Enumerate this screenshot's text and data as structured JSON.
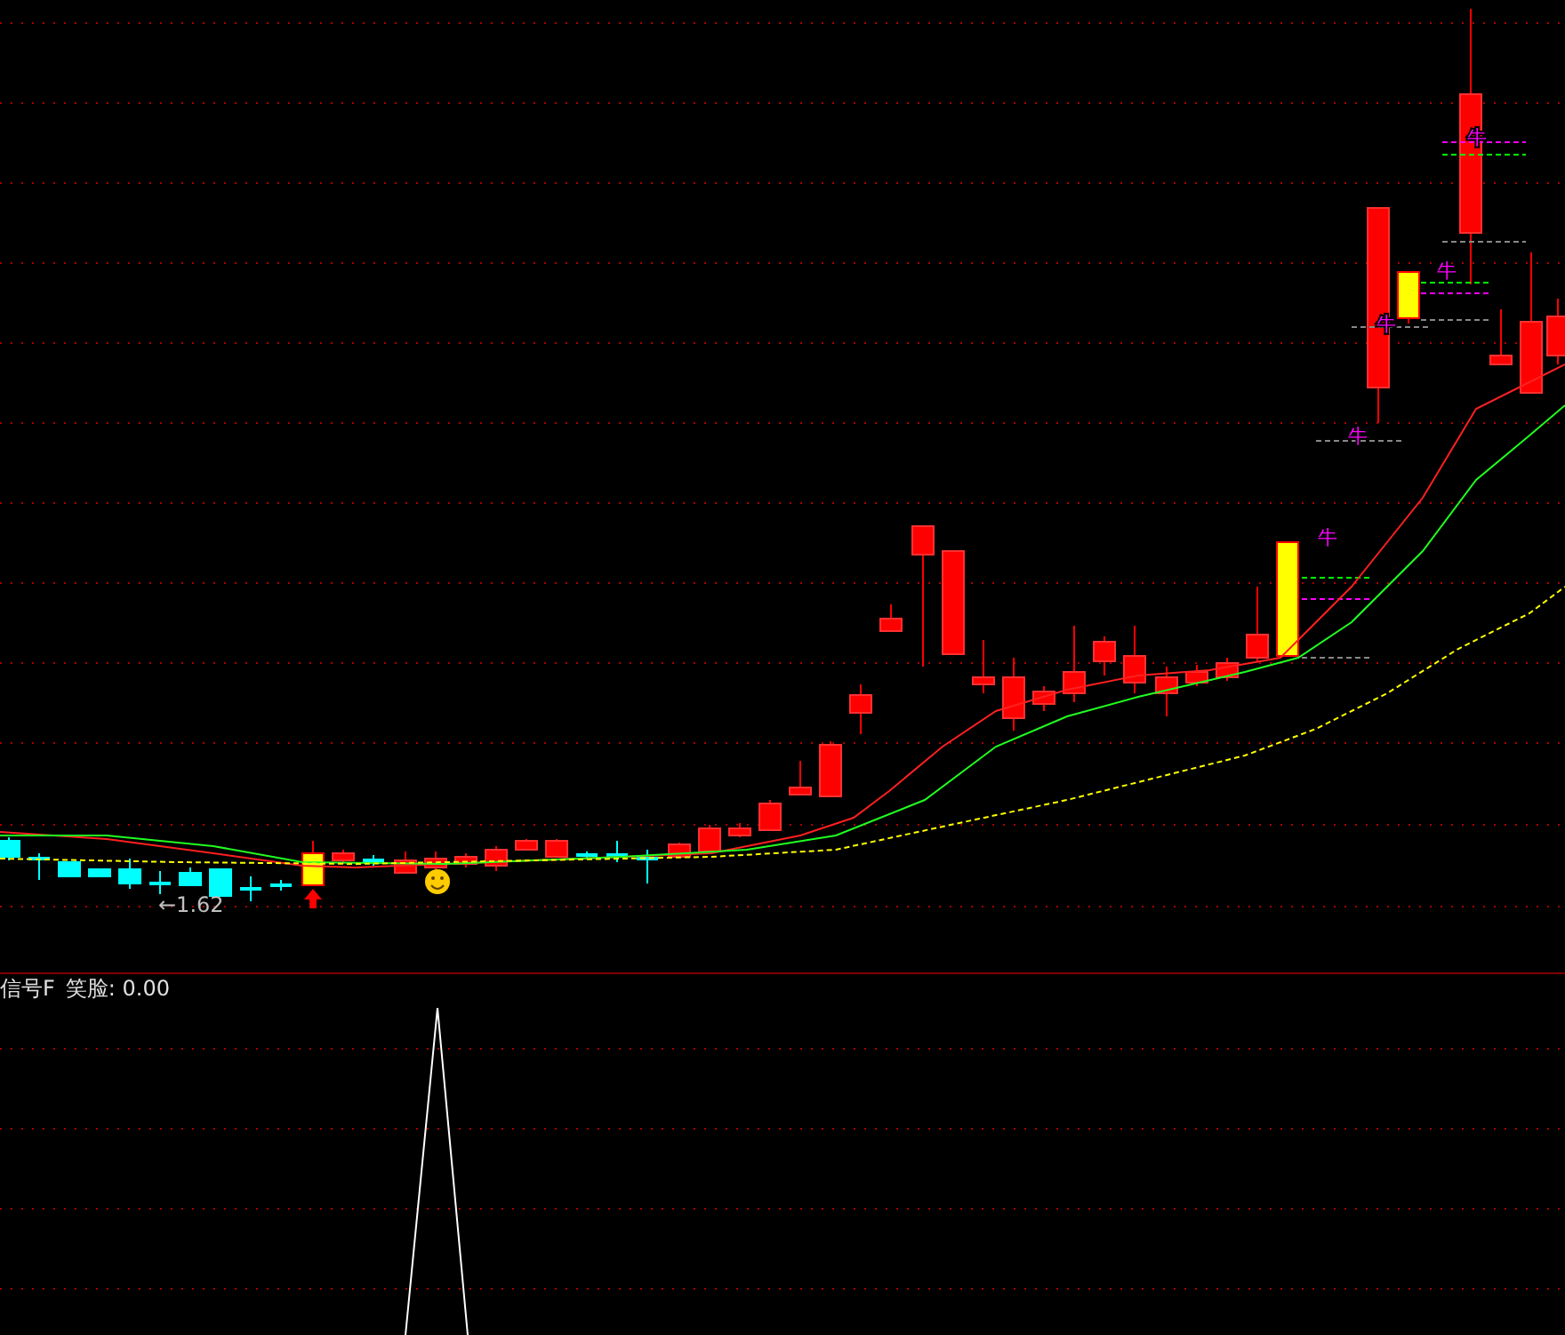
{
  "price_panel": {
    "annotation": "←1.62",
    "markers": [
      {
        "text": "牛"
      },
      {
        "text": "牛"
      },
      {
        "text": "牛"
      },
      {
        "text": "牛"
      },
      {
        "text": "牛"
      }
    ]
  },
  "indicator_panel": {
    "title": "信号F",
    "reading": "笑脸: 0.00"
  }
}
